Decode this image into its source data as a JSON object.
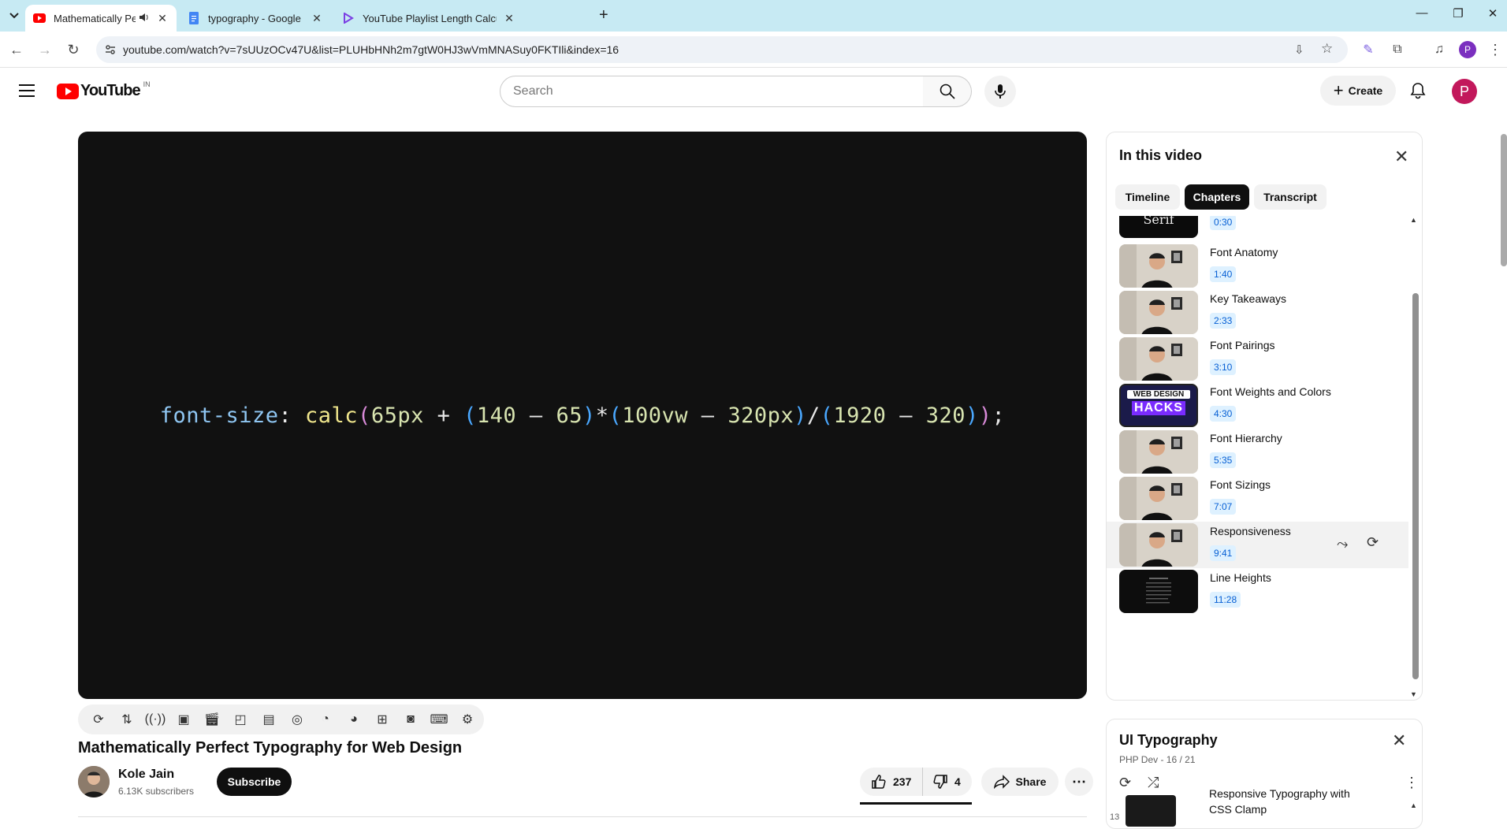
{
  "browser": {
    "tabs": [
      {
        "title": "Mathematically Perfect Typog",
        "active": true,
        "audio": true
      },
      {
        "title": "typography - Google Docs",
        "active": false
      },
      {
        "title": "YouTube Playlist Length Calcula",
        "active": false
      }
    ],
    "new_tab": "+",
    "url": "youtube.com/watch?v=7sUUzOCv47U&list=PLUHbHNh2m7gtW0HJ3wVmMNASuy0FKTIli&index=16",
    "profile_letter": "P"
  },
  "youtube": {
    "logo_text": "YouTube",
    "region": "IN",
    "search_placeholder": "Search",
    "create_label": "Create",
    "avatar_letter": "P"
  },
  "player": {
    "code_tokens": [
      {
        "t": "font-size",
        "c": "c-prop"
      },
      {
        "t": ": ",
        "c": "c-p"
      },
      {
        "t": "calc",
        "c": "c-fn"
      },
      {
        "t": "(",
        "c": "c-par1"
      },
      {
        "t": "65px",
        "c": "c-num"
      },
      {
        "t": " + ",
        "c": "c-op"
      },
      {
        "t": "(",
        "c": "c-par2"
      },
      {
        "t": "140",
        "c": "c-num"
      },
      {
        "t": " – ",
        "c": "c-op"
      },
      {
        "t": "65",
        "c": "c-num"
      },
      {
        "t": ")",
        "c": "c-par2"
      },
      {
        "t": "*",
        "c": "c-op"
      },
      {
        "t": "(",
        "c": "c-par2"
      },
      {
        "t": "100vw",
        "c": "c-num"
      },
      {
        "t": " – ",
        "c": "c-op"
      },
      {
        "t": "320px",
        "c": "c-num"
      },
      {
        "t": ")",
        "c": "c-par2"
      },
      {
        "t": "/",
        "c": "c-op"
      },
      {
        "t": "(",
        "c": "c-par2"
      },
      {
        "t": "1920",
        "c": "c-num"
      },
      {
        "t": " – ",
        "c": "c-op"
      },
      {
        "t": "320",
        "c": "c-num"
      },
      {
        "t": ")",
        "c": "c-par2"
      },
      {
        "t": ")",
        "c": "c-par1"
      },
      {
        "t": ";",
        "c": "c-p"
      }
    ]
  },
  "video": {
    "title": "Mathematically Perfect Typography for Web Design",
    "channel": "Kole Jain",
    "subscribers": "6.13K subscribers",
    "subscribe_label": "Subscribe",
    "likes": "237",
    "dislikes": "4",
    "share_label": "Share"
  },
  "chapters": {
    "title": "In this video",
    "tabs": [
      "Timeline",
      "Chapters",
      "Transcript"
    ],
    "selected_tab": "Chapters",
    "partial_first": {
      "time": "0:30",
      "thumb_text": "Serif"
    },
    "items": [
      {
        "name": "Font Anatomy",
        "time": "1:40",
        "thumb": "person"
      },
      {
        "name": "Key Takeaways",
        "time": "2:33",
        "thumb": "person"
      },
      {
        "name": "Font Pairings",
        "time": "3:10",
        "thumb": "person"
      },
      {
        "name": "Font Weights and Colors",
        "time": "4:30",
        "thumb": "hacks"
      },
      {
        "name": "Font Hierarchy",
        "time": "5:35",
        "thumb": "person"
      },
      {
        "name": "Font Sizings",
        "time": "7:07",
        "thumb": "person"
      },
      {
        "name": "Responsiveness",
        "time": "9:41",
        "thumb": "person",
        "current": true
      },
      {
        "name": "Line Heights",
        "time": "11:28",
        "thumb": "dark"
      }
    ],
    "hacks_thumb_line1": "WEB DESIGN",
    "hacks_thumb_line2": "HACKS"
  },
  "playlist": {
    "title": "UI Typography",
    "subtitle": "PHP Dev - 16 / 21",
    "row_index": "13",
    "row_title_line1": "Responsive Typography with",
    "row_title_line2": "CSS Clamp"
  },
  "colors": {
    "chrome_tabstrip": "#c7eaf3",
    "yt_red": "#ff0000",
    "avatar": "#c2185b",
    "chapter_time_bg": "#def1ff",
    "chapter_time_text": "#065fd4"
  }
}
